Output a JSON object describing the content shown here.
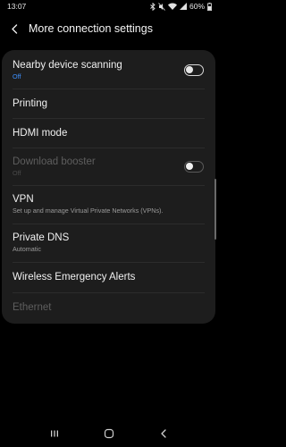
{
  "status_bar": {
    "time": "13:07",
    "battery": "60%",
    "icons": [
      "bluetooth-icon",
      "mute-icon",
      "wifi-icon",
      "signal-icon",
      "battery-icon"
    ]
  },
  "header": {
    "title": "More connection settings",
    "back_icon": "back-arrow-icon"
  },
  "settings": {
    "nearby": {
      "title": "Nearby device scanning",
      "status": "Off",
      "toggle_on": false
    },
    "printing": {
      "title": "Printing"
    },
    "hdmi": {
      "title": "HDMI mode"
    },
    "download_booster": {
      "title": "Download booster",
      "status": "Off",
      "toggle_on": false,
      "enabled": false
    },
    "vpn": {
      "title": "VPN",
      "desc": "Set up and manage Virtual Private Networks (VPNs)."
    },
    "private_dns": {
      "title": "Private DNS",
      "status": "Automatic"
    },
    "emergency_alerts": {
      "title": "Wireless Emergency Alerts"
    },
    "ethernet": {
      "title": "Ethernet",
      "enabled": false
    }
  },
  "nav_bar": {
    "icons": [
      "recents-icon",
      "home-icon",
      "back-icon"
    ]
  },
  "colors": {
    "accent": "#3e91ff",
    "card": "#1d1d1d",
    "background": "#000000"
  }
}
